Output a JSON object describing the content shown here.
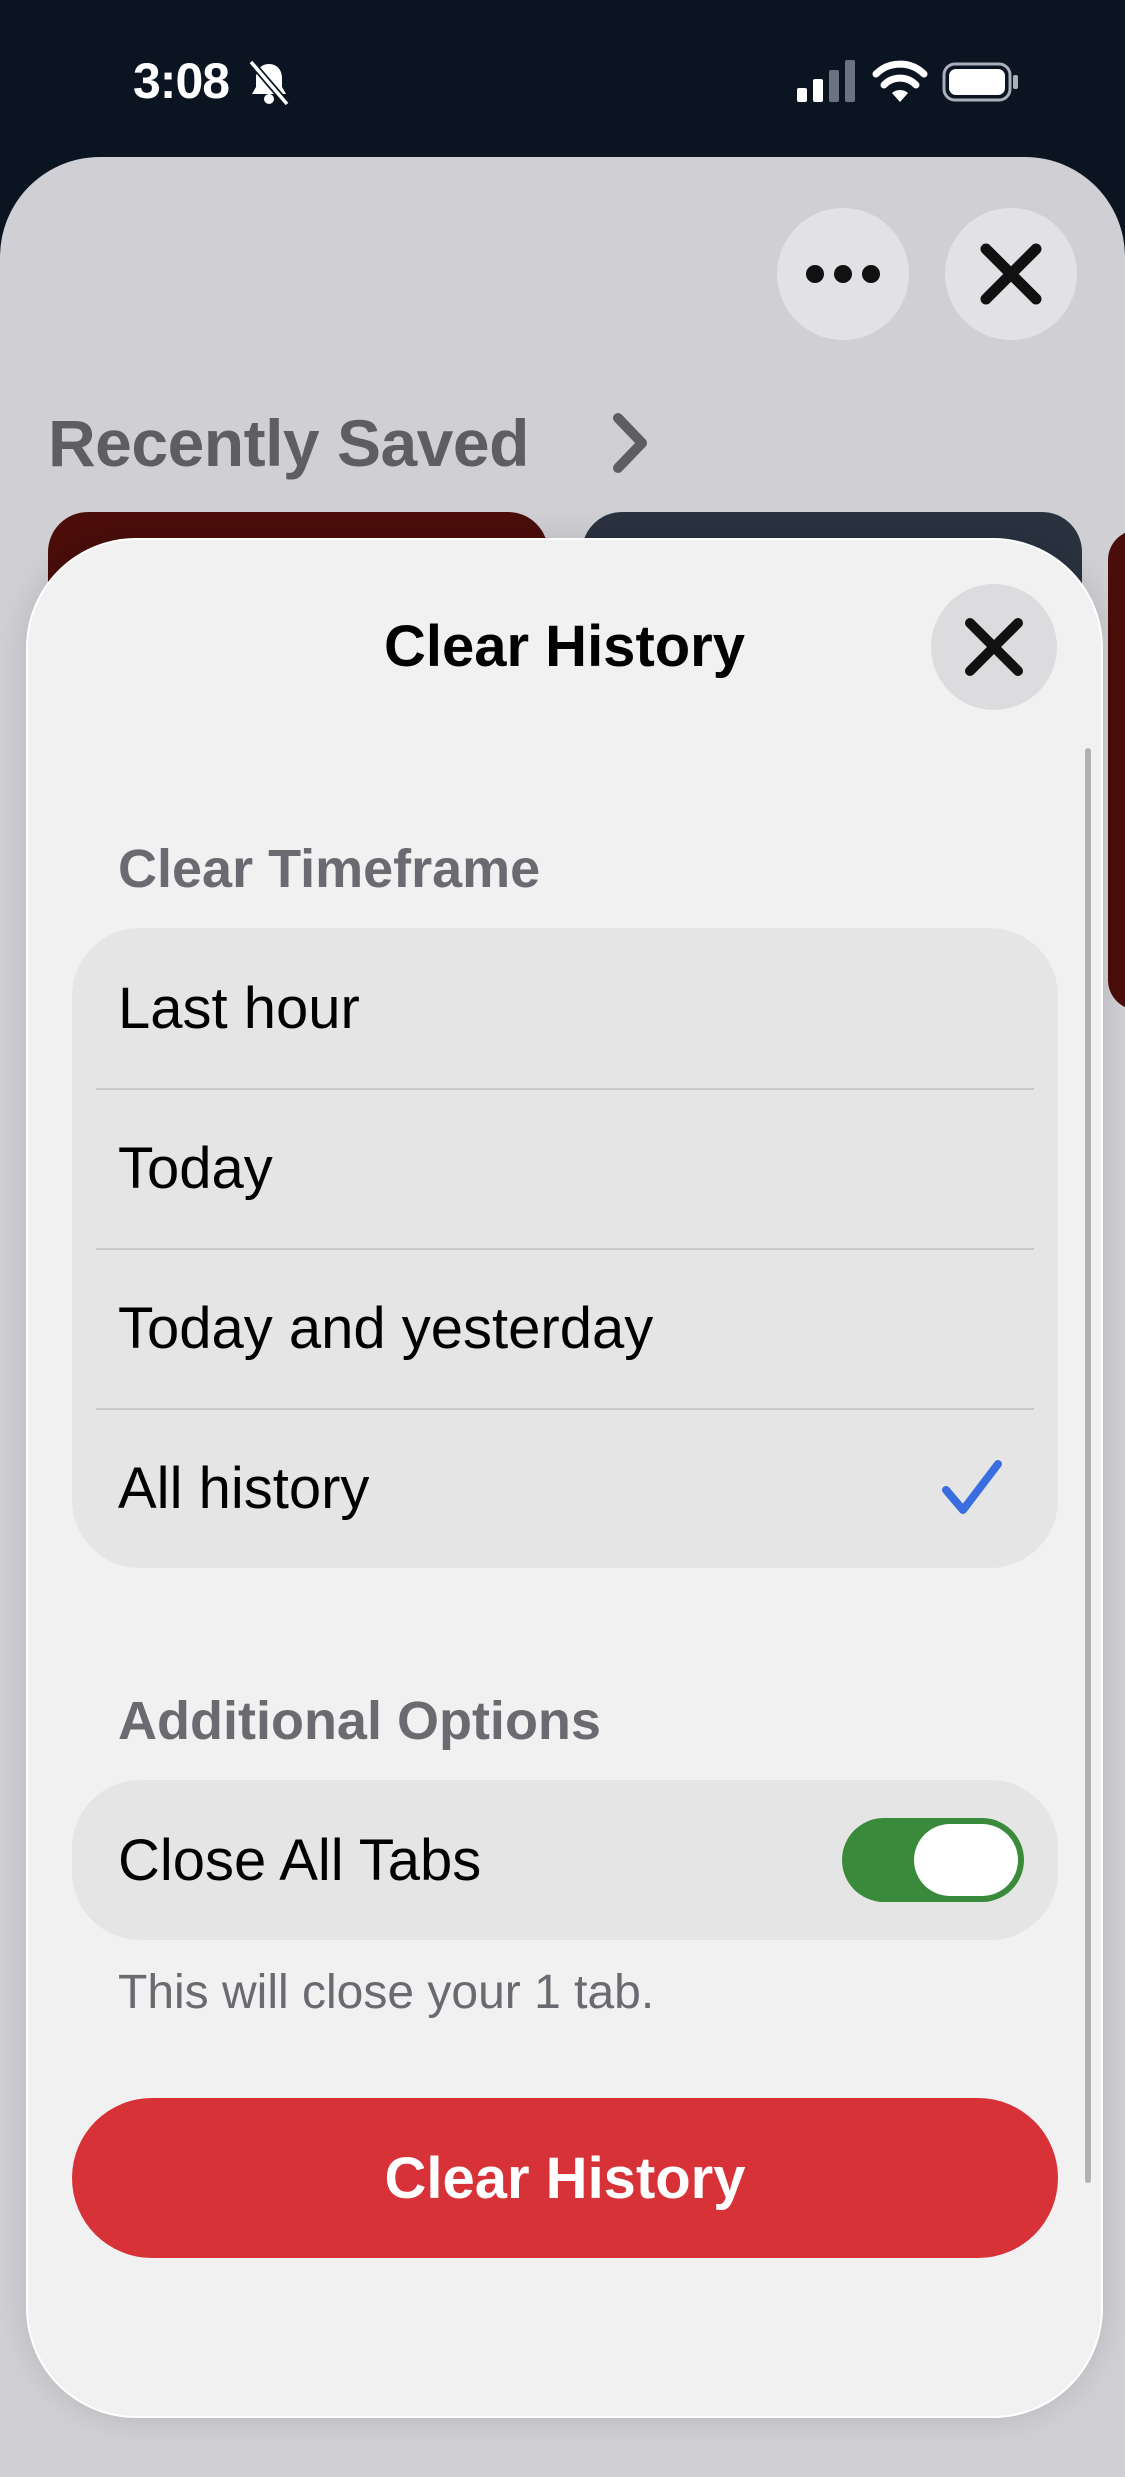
{
  "status_bar": {
    "time": "3:08",
    "icons": [
      "bell-slash-icon",
      "cellular-signal-icon",
      "wifi-icon",
      "battery-icon"
    ]
  },
  "background": {
    "recent_title": "Recently Saved",
    "icons": [
      "more-icon",
      "close-icon",
      "chevron-right-icon"
    ]
  },
  "modal": {
    "title": "Clear History",
    "close_icon": "close-icon",
    "timeframe": {
      "header": "Clear Timeframe",
      "options": [
        {
          "label": "Last hour",
          "selected": false
        },
        {
          "label": "Today",
          "selected": false
        },
        {
          "label": "Today and yesterday",
          "selected": false
        },
        {
          "label": "All history",
          "selected": true
        }
      ],
      "check_icon": "checkmark-icon"
    },
    "additional": {
      "header": "Additional Options",
      "close_all_tabs_label": "Close All Tabs",
      "close_all_tabs_on": true,
      "note": "This will close your 1 tab."
    },
    "action_button": "Clear History"
  },
  "colors": {
    "accent_check": "#3a6ee0",
    "toggle_on": "#3a8a3c",
    "danger": "#d73238",
    "status_bg": "#0b1522"
  }
}
